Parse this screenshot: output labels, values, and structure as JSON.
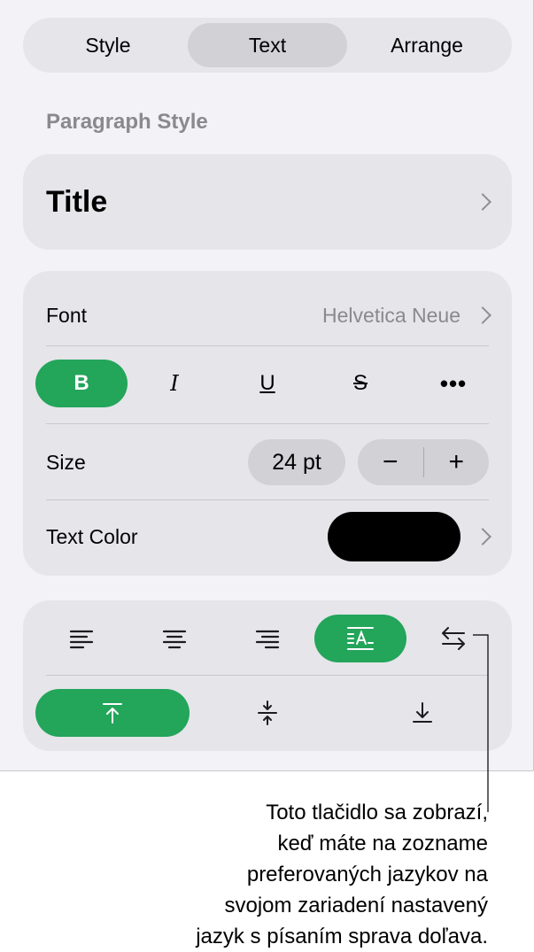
{
  "tabs": [
    {
      "label": "Style",
      "selected": false
    },
    {
      "label": "Text",
      "selected": true
    },
    {
      "label": "Arrange",
      "selected": false
    }
  ],
  "paragraph_style": {
    "section_title": "Paragraph Style",
    "value": "Title"
  },
  "font": {
    "label": "Font",
    "value": "Helvetica Neue",
    "styles": {
      "bold": "B",
      "italic": "I",
      "underline": "U",
      "strikethrough": "S",
      "more": "•••"
    },
    "bold_active": true
  },
  "size": {
    "label": "Size",
    "value": "24 pt",
    "decrement": "−",
    "increment": "+"
  },
  "text_color": {
    "label": "Text Color",
    "color": "#000000"
  },
  "alignment": {
    "options": [
      "align-left",
      "align-center",
      "align-right",
      "fit-text",
      "text-direction"
    ],
    "selected": "fit-text"
  },
  "vertical_alignment": {
    "options": [
      "top",
      "middle",
      "bottom"
    ],
    "selected": "top"
  },
  "accent_color": "#23a55a",
  "callout": {
    "lines": [
      "Toto tlačidlo sa zobrazí,",
      "keď máte na zozname",
      "preferovaných jazykov na",
      "svojom zariadení nastavený",
      "jazyk s písaním sprava doľava."
    ]
  }
}
